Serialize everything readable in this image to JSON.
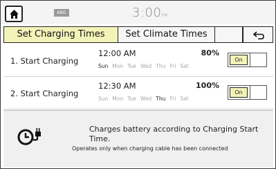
{
  "status": {
    "badge": "ABG",
    "time": "3:00",
    "ampm": "PM"
  },
  "tabs": {
    "active": "Set Charging Times",
    "inactive": "Set Climate Times"
  },
  "rows": [
    {
      "label": "1. Start Charging",
      "time": "12:00 AM",
      "percent": "80%",
      "days": [
        "Sun",
        "Mon",
        "Tue",
        "Wed",
        "Thu",
        "Fri",
        "Sat"
      ],
      "active_day": "Sun",
      "toggle": "On"
    },
    {
      "label": "2. Start Charging",
      "time": "12:30 AM",
      "percent": "100%",
      "days": [
        "Sun",
        "Mon",
        "Tue",
        "Wed",
        "Thu",
        "Fri",
        "Sat"
      ],
      "active_day": "Thu",
      "toggle": "On"
    }
  ],
  "info": {
    "main": "Charges battery according to Charging Start Time.",
    "sub": "Operates only when charging cable has been connected"
  },
  "icons": {
    "home": "home-icon",
    "back": "back-arrow-icon",
    "plug": "clock-plug-icon"
  },
  "colors": {
    "active_tab": "#f3f3b9",
    "toggle_on": "#f3f3b9",
    "info_bg": "#f0f0f0"
  }
}
